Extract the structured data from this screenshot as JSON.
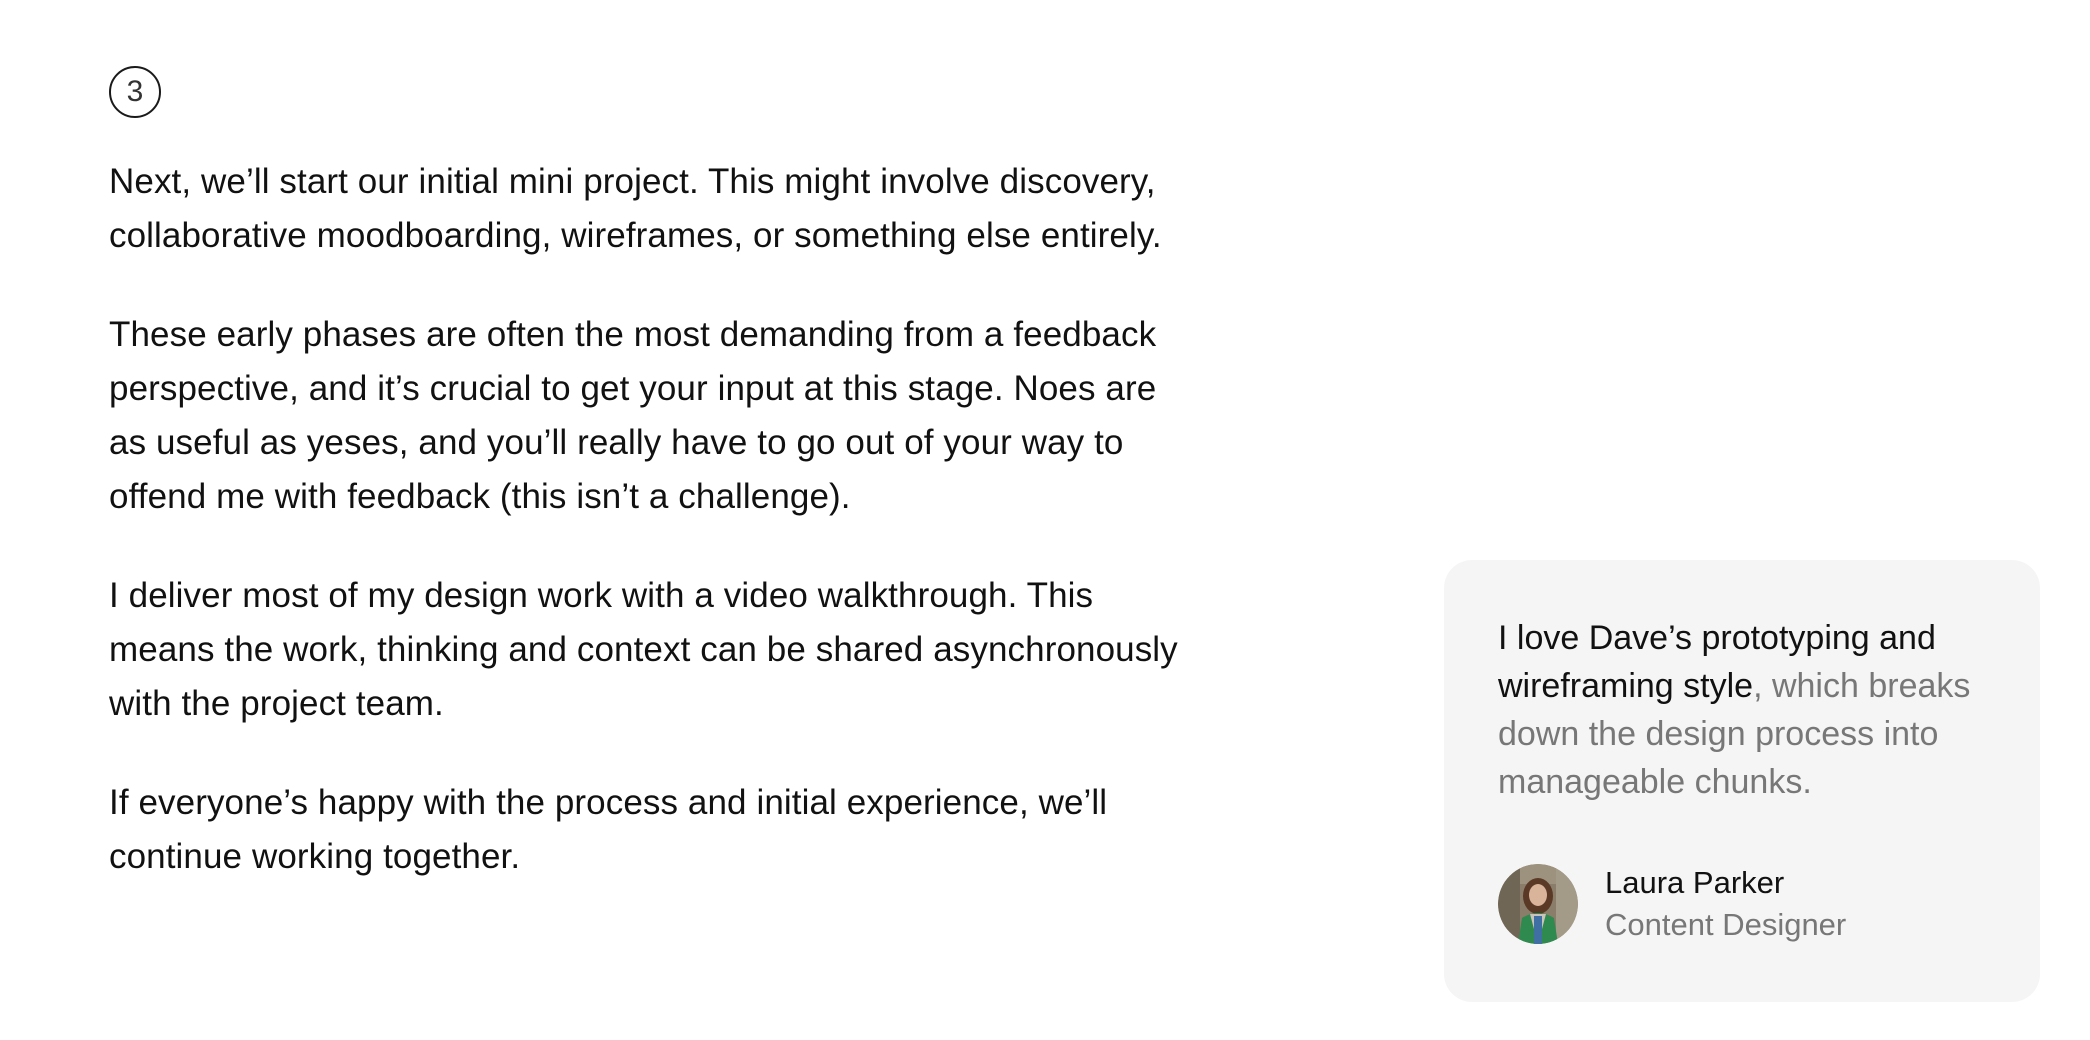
{
  "step": {
    "number": "3"
  },
  "paragraphs": [
    "Next, we’ll start our initial mini project. This might involve discovery, collaborative moodboarding, wireframes, or something else entirely.",
    "These early phases are often the most demanding from a feedback perspective, and it’s crucial to get your input at this stage. Noes are as useful as yeses, and you’ll really have to go out of your way to offend me with feedback (this isn’t a challenge).",
    "I deliver most of my design work with a video walkthrough. This means the work, thinking and context can be shared asynchronously with the project team.",
    "If everyone’s happy with the process and initial experience, we’ll continue working together."
  ],
  "testimonial": {
    "quote_highlight": "I love Dave’s prototyping and wireframing style",
    "quote_rest": ", which breaks down the design process into manageable chunks.",
    "author_name": "Laura Parker",
    "author_role": "Content Designer",
    "avatar_icon": "person-photo-avatar"
  },
  "colors": {
    "text": "#111111",
    "muted": "#777777",
    "card_background": "#f5f5f5"
  }
}
